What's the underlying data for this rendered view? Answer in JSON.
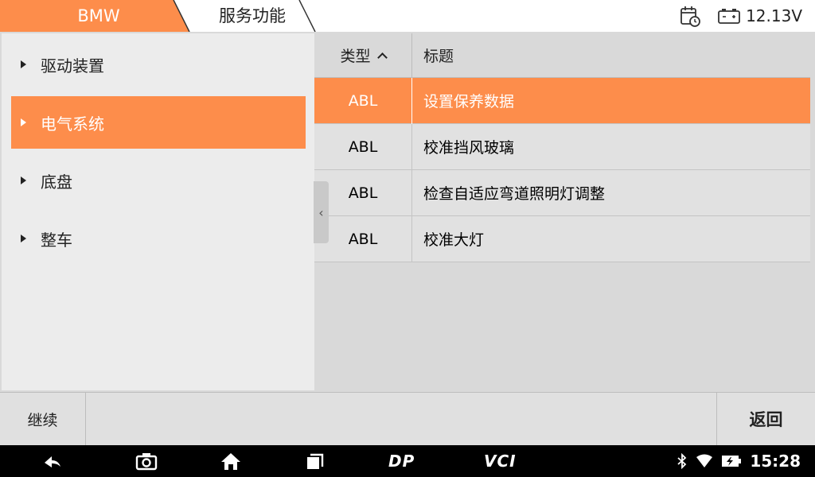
{
  "header": {
    "brand": "BMW",
    "page_title": "服务功能",
    "voltage": "12.13V",
    "accent_color": "#fd8d4b"
  },
  "categories": [
    {
      "label": "驱动装置",
      "selected": false
    },
    {
      "label": "电气系统",
      "selected": true
    },
    {
      "label": "底盘",
      "selected": false
    },
    {
      "label": "整车",
      "selected": false
    }
  ],
  "table": {
    "col_type": "类型",
    "col_title": "标题",
    "rows": [
      {
        "type": "ABL",
        "title": "设置保养数据",
        "selected": true
      },
      {
        "type": "ABL",
        "title": "校准挡风玻璃",
        "selected": false
      },
      {
        "type": "ABL",
        "title": "检查自适应弯道照明灯调整",
        "selected": false
      },
      {
        "type": "ABL",
        "title": "校准大灯",
        "selected": false
      }
    ]
  },
  "actions": {
    "continue_label": "继续",
    "back_label": "返回"
  },
  "navbar": {
    "dp_label": "DP",
    "vci_label": "VCI",
    "clock": "15:28",
    "icons": [
      "back-arrow-icon",
      "camera-icon",
      "home-icon",
      "recents-icon",
      "bluetooth-icon",
      "wifi-icon",
      "battery-charging-icon"
    ]
  }
}
